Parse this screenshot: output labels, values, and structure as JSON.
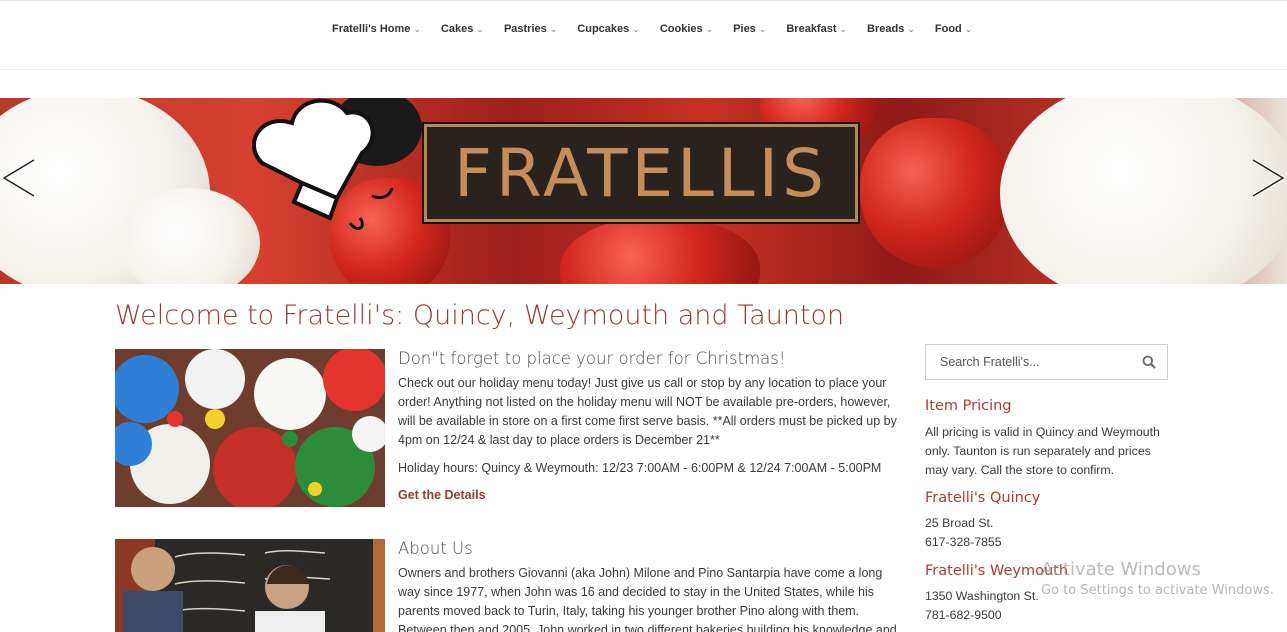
{
  "nav": {
    "items": [
      {
        "label": "Fratelli's Home"
      },
      {
        "label": "Cakes"
      },
      {
        "label": "Pastries"
      },
      {
        "label": "Cupcakes"
      },
      {
        "label": "Cookies"
      },
      {
        "label": "Pies"
      },
      {
        "label": "Breakfast"
      },
      {
        "label": "Breads"
      },
      {
        "label": "Food"
      }
    ],
    "caret": "⌄"
  },
  "hero": {
    "logo_text": "FRATELLIS",
    "prev_icon": "chevron-left-icon",
    "next_icon": "chevron-right-icon"
  },
  "main": {
    "title": "Welcome to Fratelli's: Quincy, Weymouth and Taunton",
    "posts": [
      {
        "title": "Don\"t forget to place your order for Christmas!",
        "body": "Check out our holiday menu today! Just give us call or stop by any location to place your order! Anything not listed on the holiday menu will NOT be available pre-orders, however, will be available in store on a first come first serve basis. **All orders must be picked up by 4pm on 12/24 & last day to place orders is December 21**",
        "hours": "Holiday hours: Quincy & Weymouth: 12/23 7:00AM - 6:00PM & 12/24 7:00AM - 5:00PM",
        "link": "Get the Details"
      },
      {
        "title": "About Us",
        "body": "Owners and brothers Giovanni (aka John) Milone and Pino Santarpia have come a long way since 1977, when John was 16 and decided to stay in the United States, while his parents moved back to Turin, Italy, taking his younger brother Pino along with them. Between then and 2005, John worked in two different bakeries building his knowledge and expertise as a"
      }
    ]
  },
  "sidebar": {
    "search_placeholder": "Search Fratelli's...",
    "sections": [
      {
        "heading": "Item Pricing",
        "lines": [
          "All pricing is valid in Quincy and Weymouth only. Taunton is run separately and prices may vary. Call the store to confirm."
        ]
      },
      {
        "heading": "Fratelli's Quincy",
        "lines": [
          "25 Broad St.",
          "617-328-7855"
        ]
      },
      {
        "heading": "Fratelli's Weymouth",
        "lines": [
          "1350 Washington St.",
          "781-682-9500"
        ]
      }
    ]
  },
  "watermark": {
    "title": "Activate Windows",
    "subtitle": "Go to Settings to activate Windows."
  },
  "colors": {
    "accent": "#9a3830",
    "heading_red": "#b03b30"
  }
}
